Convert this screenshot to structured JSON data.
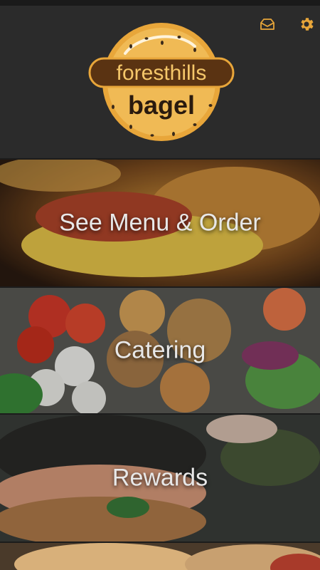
{
  "header": {
    "logo_text_top": "foresthills",
    "logo_text_bottom": "bagel",
    "inbox_icon": "inbox-icon",
    "settings_icon": "gear-icon",
    "accent_color": "#e8a63a"
  },
  "tiles": [
    {
      "label": "See Menu & Order"
    },
    {
      "label": "Catering"
    },
    {
      "label": "Rewards"
    }
  ]
}
